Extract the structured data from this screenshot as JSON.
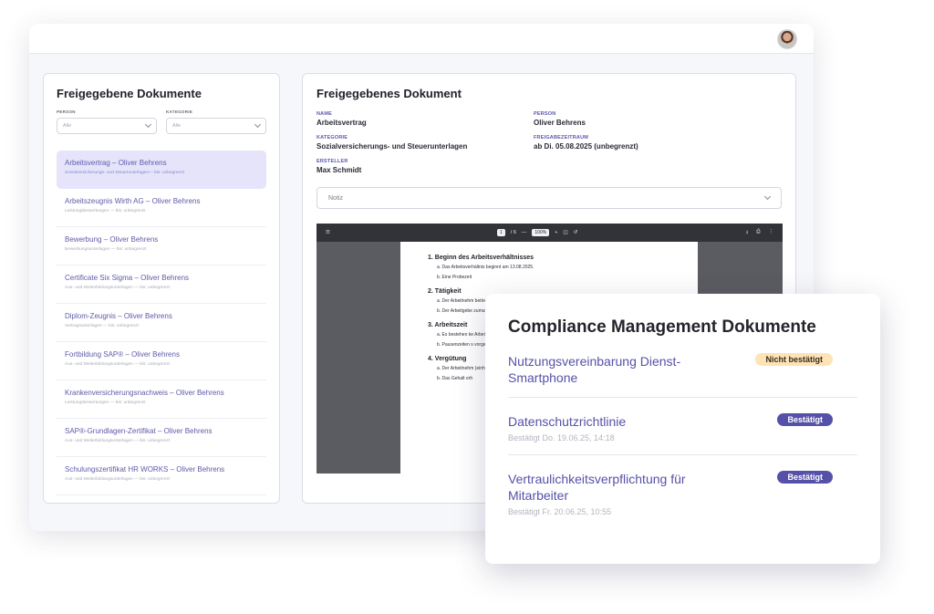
{
  "left": {
    "title": "Freigegebene Dokumente",
    "filters": [
      {
        "label": "PERSON",
        "value": "Alle"
      },
      {
        "label": "KATEGORIE",
        "value": "Alle"
      }
    ],
    "documents": [
      {
        "name": "Arbeitsvertrag – Oliver Behrens",
        "meta": "Sozialversicherungs- und Steuerunterlagen— bis: unbegrenzt",
        "active": true
      },
      {
        "name": "Arbeitszeugnis Wirth AG – Oliver Behrens",
        "meta": "Leistungsbewertungen — bis: unbegrenzt"
      },
      {
        "name": "Bewerbung – Oliver Behrens",
        "meta": "Bewerbungsunterlagen — bis: unbegrenzt"
      },
      {
        "name": "Certificate Six Sigma – Oliver Behrens",
        "meta": "Aus- und Weiterbildungsunterlagen — bis: unbegrenzt"
      },
      {
        "name": "Diplom-Zeugnis – Oliver Behrens",
        "meta": "Vertragsunterlagen — bis: unbegrenzt"
      },
      {
        "name": "Fortbildung SAP® – Oliver Behrens",
        "meta": "Aus- und Weiterbildungsunterlagen — bis: unbegrenzt"
      },
      {
        "name": "Krankenversicherungsnachweis – Oliver Behrens",
        "meta": "Leistungsbewertungen — bis: unbegrenzt"
      },
      {
        "name": "SAP®-Grundlagen-Zertifikat – Oliver Behrens",
        "meta": "Aus- und Weiterbildungsunterlagen — bis: unbegrenzt"
      },
      {
        "name": "Schulungszertifikat HR WORKS – Oliver Behrens",
        "meta": "Aus- und Weiterbildungsunterlagen — bis: unbegrenzt"
      }
    ]
  },
  "detail": {
    "title": "Freigegebenes Dokument",
    "fields": [
      {
        "label": "NAME",
        "value": "Arbeitsvertrag"
      },
      {
        "label": "PERSON",
        "value": "Oliver Behrens"
      },
      {
        "label": "KATEGORIE",
        "value": "Sozialversicherungs- und Steuerunterlagen"
      },
      {
        "label": "FREIGABEZEITRAUM",
        "value": "ab Di. 05.08.2025 (unbegrenzt)"
      },
      {
        "label": "ERSTELLER",
        "value": "Max Schmidt"
      }
    ],
    "note_label": "Notiz"
  },
  "viewer": {
    "page_current": "1",
    "page_total": "/ 6",
    "zoom": "100%",
    "sections": [
      {
        "title": "1. Beginn des Arbeitsverhältnisses",
        "items": [
          "a. Das Arbeitsverhältnis beginnt am 13.08.2025.",
          "b. Eine Probezeit"
        ]
      },
      {
        "title": "2. Tätigkeit",
        "items": [
          "a. Der Arbeitnehm betrieblicher Er",
          "b. Der Arbeitgebe zumutbare Täti"
        ]
      },
      {
        "title": "3. Arbeitszeit",
        "items": [
          "a. Es bestehen ke Arbeitszeit gru beeinträchtigt v",
          "b. Pausenzeiten s vorgesehen un"
        ]
      },
      {
        "title": "4. Vergütung",
        "items": [
          "a. Der Arbeitnehm (einhundertzw",
          "b. Das Gehalt erh"
        ]
      }
    ]
  },
  "compliance": {
    "title": "Compliance Management Dokumente",
    "items": [
      {
        "name": "Nutzungsvereinbarung Dienst-Smartphone",
        "meta": "",
        "badge": "Nicht bestätigt",
        "status": "pending"
      },
      {
        "name": "Datenschutzrichtlinie",
        "meta": "Bestätigt Do. 19.06.25, 14:18",
        "badge": "Bestätigt",
        "status": "ok"
      },
      {
        "name": "Vertraulichkeitsverpflichtung für Mitarbeiter",
        "meta": "Bestätigt Fr. 20.06.25, 10:55",
        "badge": "Bestätigt",
        "status": "ok"
      }
    ]
  },
  "colors": {
    "accent": "#5651a8",
    "active_bg": "#e6e4fb",
    "pending_bg": "#fde3b6"
  }
}
